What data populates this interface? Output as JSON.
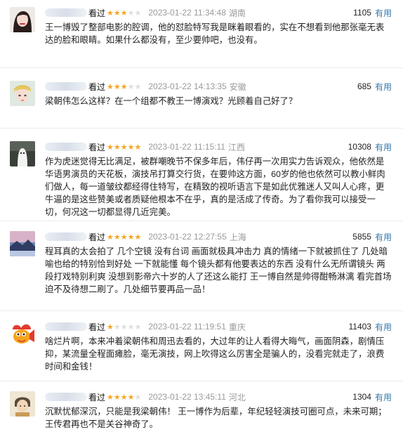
{
  "colors": {
    "star_on": "#f5a623",
    "star_off": "#dedede",
    "link": "#3377aa"
  },
  "reviews": [
    {
      "action": "看过",
      "rating": 3,
      "time": "2023-01-22 11:34:48",
      "location": "湖南",
      "votes": "1105",
      "useful": "有用",
      "avatar_icon": "user-portrait-icon",
      "text": "王一博毁了整部电影的腔调，他的怼脸特写我是眯着眼看的，实在不想看到他那张毫无表达的脸和眼睛。如果什么都没有，至少要帅吧，也没有。"
    },
    {
      "action": "看过",
      "rating": 3,
      "time": "2023-01-22 14:13:35",
      "location": "安徽",
      "votes": "685",
      "useful": "有用",
      "avatar_icon": "user-portrait-icon",
      "text": "梁朝伟怎么这样？在一个组都不教王一博演戏？光顾着自己好了？"
    },
    {
      "action": "看过",
      "rating": 5,
      "time": "2023-01-22 11:15:11",
      "location": "江西",
      "votes": "10308",
      "useful": "有用",
      "avatar_icon": "user-ghost-icon",
      "text": "作为虎迷觉得无比满足，被群嘲晚节不保多年后，伟仔再一次用实力告诉观众，他依然是华语男演员的天花板，演技吊打算交行货，在要帅这方面，60岁的他也依然可以教小鲜肉们做人，每一道皱纹都经得住特写，在精致的视听语言下是如此优雅迷人又叫人心疼，更牛逼的是这些赞美或者质疑他根本不在乎，真的是活成了传奇。为了看你我可以接受一切，何况这一切都显得几近完美。"
    },
    {
      "action": "看过",
      "rating": 5,
      "time": "2023-01-22 12:27:55",
      "location": "上海",
      "votes": "5855",
      "useful": "有用",
      "avatar_icon": "user-landscape-icon",
      "text": "程耳真的太会拍了 几个空镜 没有台词 画面就极具冲击力 真的情绪一下就被抓住了 几处暗喻也给的特别恰到好处 一下就能懂 每个镜头都有他要表达的东西 没有什么无所谓镜头 两段打戏特别利爽 没想到影帝六十岁的人了还这么能打 王一博自然是帅得酣畅淋漓 看完首场 迫不及待想二刷了。几处细节要再品一品！"
    },
    {
      "action": "看过",
      "rating": 1,
      "time": "2023-01-22 11:19:51",
      "location": "重庆",
      "votes": "11403",
      "useful": "有用",
      "avatar_icon": "user-goldfish-icon",
      "text": "啥烂片啊，本来冲着梁朝伟和周迅去看的，大过年的让人看得大晦气，画面阴森，剧情压抑，某流量全程面瘫脸，毫无演技，网上吹得这么厉害全是骗人的，没看完就走了，浪费时间和金钱！"
    },
    {
      "action": "看过",
      "rating": 4,
      "time": "2023-01-22 13:45:11",
      "location": "河北",
      "votes": "1304",
      "useful": "有用",
      "avatar_icon": "user-illustration-icon",
      "text": "沉默忧郁深沉，只能是我梁朝伟！ 王一博作为后辈，年纪轻轻演技可圈可点，未来可期； 王传君再也不是关谷神奇了。"
    }
  ]
}
